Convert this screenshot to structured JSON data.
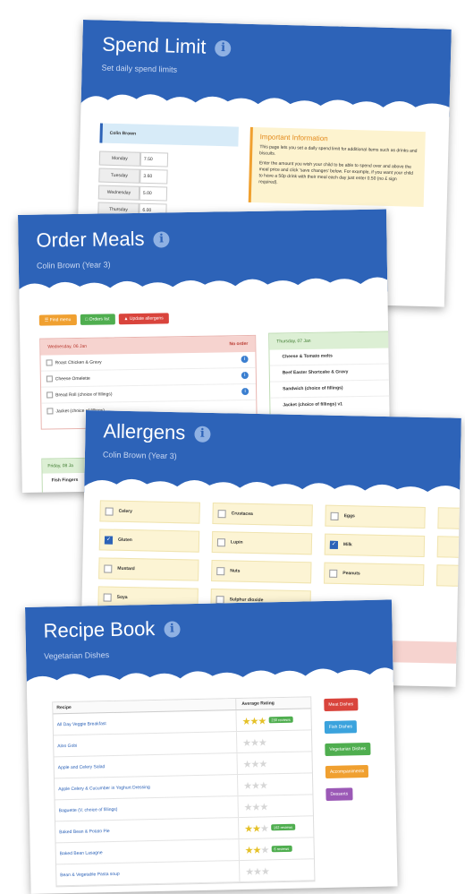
{
  "spend_limit": {
    "title": "Spend Limit",
    "subtitle": "Set daily spend limits",
    "student_name": "Colin Brown",
    "days": [
      {
        "day": "Monday",
        "value": "7.50"
      },
      {
        "day": "Tuesday",
        "value": "3.60"
      },
      {
        "day": "Wednesday",
        "value": "5.00"
      },
      {
        "day": "Thursday",
        "value": "6.00"
      }
    ],
    "info_title": "Important Information",
    "info_text_1": "This page lets you set a daily spend limit for additional items such as drinks and biscuits.",
    "info_text_2": "Enter the amount you wish your child to be able to spend over and above the meal price and click 'save changes' below. For example, if you want your child to have a 50p drink with their meal each day just enter 0.50 (no £ sign required)."
  },
  "order_meals": {
    "title": "Order Meals",
    "subtitle": "Colin Brown (Year 3)",
    "buttons": [
      "Find menu",
      "Orders list",
      "Update allergens"
    ],
    "button_colors": [
      "#f0a030",
      "#4fae4f",
      "#d9443c"
    ],
    "wed_header": "Wednesday, 06 Jan",
    "wed_status": "No order",
    "wed_items": [
      "Roast Chicken & Gravy",
      "Cheese Omelette",
      "Bread Roll (choice of fillings)",
      "Jacket (choice of fillings)"
    ],
    "thu_header": "Thursday, 07 Jan",
    "thu_items": [
      "Cheese & Tomato melts",
      "Beef Easter Shortcake & Gravy",
      "Sandwich (choice of fillings)",
      "Jacket (choice of fillings) v1"
    ],
    "fri_header": "Friday, 08 Ja",
    "fri_items": [
      "Fish Fingers"
    ]
  },
  "allergens": {
    "title": "Allergens",
    "subtitle": "Colin Brown (Year 3)",
    "items": [
      {
        "label": "Celery",
        "checked": false
      },
      {
        "label": "Crustacea",
        "checked": false
      },
      {
        "label": "Eggs",
        "checked": false
      },
      {
        "label": "Gluten",
        "checked": true
      },
      {
        "label": "Lupin",
        "checked": false
      },
      {
        "label": "Milk",
        "checked": true
      },
      {
        "label": "Mustard",
        "checked": false
      },
      {
        "label": "Nuts",
        "checked": false
      },
      {
        "label": "Peanuts",
        "checked": false
      },
      {
        "label": "Soya",
        "checked": false
      },
      {
        "label": "Sulphur dioxide",
        "checked": false
      }
    ]
  },
  "recipe_book": {
    "title": "Recipe Book",
    "subtitle": "Vegetarian Dishes",
    "col_recipe": "Recipe",
    "col_rating": "Average Rating",
    "recipes": [
      {
        "name": "All Day Veggie Breakfast",
        "stars": 2.5,
        "reviews": "230 reviews"
      },
      {
        "name": "Aloo Gobi",
        "stars": 0,
        "reviews": ""
      },
      {
        "name": "Apple and Celery Salad",
        "stars": 0,
        "reviews": ""
      },
      {
        "name": "Apple Celery & Cucumber in Yoghurt Dressing",
        "stars": 0,
        "reviews": ""
      },
      {
        "name": "Baguette (V, choice of fillings)",
        "stars": 0,
        "reviews": ""
      },
      {
        "name": "Baked Bean & Potato Pie",
        "stars": 2,
        "reviews": "192 reviews"
      },
      {
        "name": "Baked Bean Lasagne",
        "stars": 1.5,
        "reviews": "6 reviews"
      },
      {
        "name": "Bean & Vegetable Pasta soup",
        "stars": 0,
        "reviews": ""
      }
    ],
    "categories": [
      {
        "label": "Meat Dishes",
        "color": "#d9443c"
      },
      {
        "label": "Fish Dishes",
        "color": "#3ba3dd"
      },
      {
        "label": "Vegetarian Dishes",
        "color": "#4fae4f"
      },
      {
        "label": "Accompaniments",
        "color": "#f0a030"
      },
      {
        "label": "Desserts",
        "color": "#9b59b6"
      }
    ],
    "review_badge_color": "#4fae4f"
  },
  "icons": {
    "info": "info-icon",
    "star": "star-icon",
    "checkbox": "checkbox-icon"
  }
}
